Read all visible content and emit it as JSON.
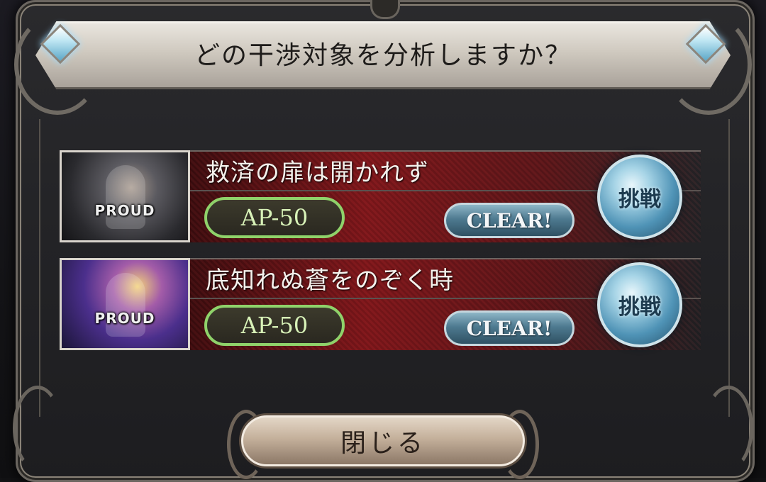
{
  "dialog": {
    "title": "どの干渉対象を分析しますか？",
    "close_label": "閉じる"
  },
  "quests": [
    {
      "name": "救済の扉は開かれず",
      "difficulty": "PROUD",
      "ap_cost": "AP-50",
      "status": "CLEAR!",
      "challenge_label": "挑戦"
    },
    {
      "name": "底知れぬ蒼をのぞく時",
      "difficulty": "PROUD",
      "ap_cost": "AP-50",
      "status": "CLEAR!",
      "challenge_label": "挑戦"
    }
  ],
  "colors": {
    "ap_border": "#8fd26a",
    "quest_red": "#8c1418",
    "clear_blue": "#4e7a90"
  }
}
